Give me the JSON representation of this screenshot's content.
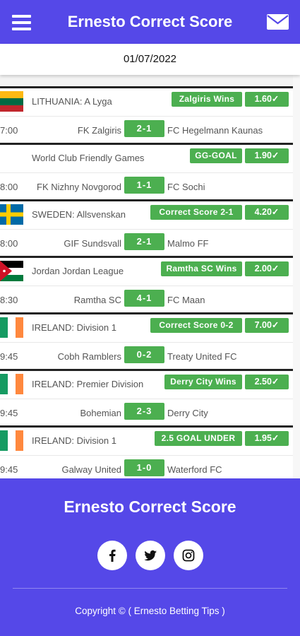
{
  "header": {
    "title": "Ernesto Correct Score",
    "menu_icon": "hamburger-menu-icon",
    "mail_icon": "mail-icon"
  },
  "date": "01/07/2022",
  "matches": [
    {
      "flag": "lithuania-flag",
      "league": "LITHUANIA: A Lyga",
      "tip": "Zalgiris Wins",
      "odds": "1.60✓",
      "time": "7:00",
      "home": "FK Zalgiris",
      "score": "2-1",
      "away": "FC Hegelmann Kaunas"
    },
    {
      "flag": "",
      "league": "World Club Friendly Games",
      "tip": "GG-GOAL",
      "odds": "1.90✓",
      "time": "8:00",
      "home": "FK Nizhny Novgorod",
      "score": "1-1",
      "away": "FC Sochi"
    },
    {
      "flag": "sweden-flag",
      "league": "SWEDEN: Allsvenskan",
      "tip": "Correct Score 2-1",
      "odds": "4.20✓",
      "time": "8:00",
      "home": "GIF Sundsvall",
      "score": "2-1",
      "away": "Malmo FF"
    },
    {
      "flag": "jordan-flag",
      "league": "Jordan Jordan League",
      "tip": "Ramtha SC Wins",
      "odds": "2.00✓",
      "time": "8:30",
      "home": "Ramtha SC",
      "score": "4-1",
      "away": "FC Maan"
    },
    {
      "flag": "ireland-flag",
      "league": "IRELAND: Division 1",
      "tip": "Correct Score 0-2",
      "odds": "7.00✓",
      "time": "9:45",
      "home": "Cobh Ramblers",
      "score": "0-2",
      "away": "Treaty United FC"
    },
    {
      "flag": "ireland-flag",
      "league": "IRELAND: Premier Division",
      "tip": "Derry City Wins",
      "odds": "2.50✓",
      "time": "9:45",
      "home": "Bohemian",
      "score": "2-3",
      "away": "Derry City"
    },
    {
      "flag": "ireland-flag",
      "league": "IRELAND: Division 1",
      "tip": "2.5 GOAL UNDER",
      "odds": "1.95✓",
      "time": "9:45",
      "home": "Galway United",
      "score": "1-0",
      "away": "Waterford FC"
    }
  ],
  "footer": {
    "title": "Ernesto Correct Score",
    "social": [
      "facebook-icon",
      "twitter-icon",
      "instagram-icon"
    ],
    "copyright": "Copyright © ( Ernesto Betting Tips )"
  },
  "colors": {
    "primary": "#5548e8",
    "accent_green": "#4caf50"
  }
}
